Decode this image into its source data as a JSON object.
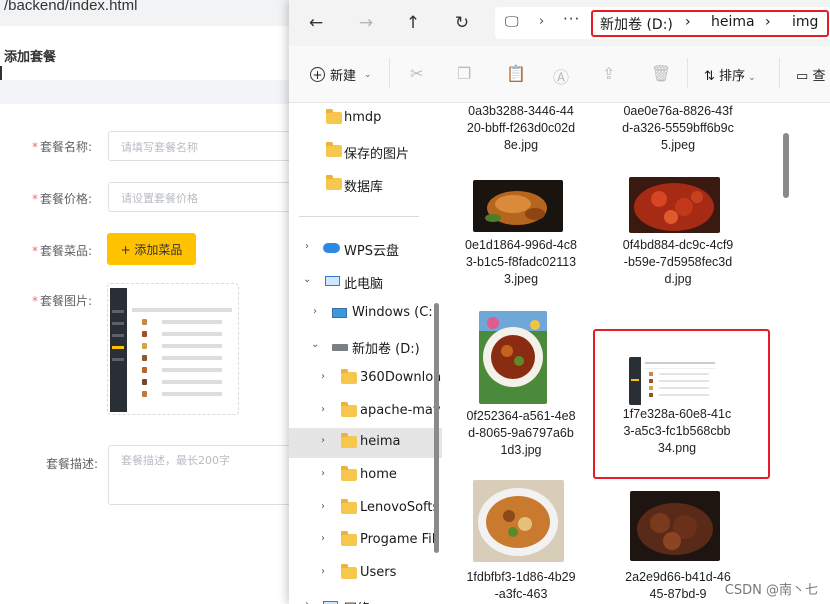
{
  "browser": {
    "url": "/backend/index.html"
  },
  "form": {
    "title": "添加套餐",
    "name_label": "套餐名称:",
    "name_placeholder": "请填写套餐名称",
    "price_label": "套餐价格:",
    "price_placeholder": "请设置套餐价格",
    "dishes_label": "套餐菜品:",
    "add_dish_button": "+ 添加菜品",
    "image_label": "套餐图片:",
    "desc_label": "套餐描述:",
    "desc_placeholder": "套餐描述，最长200字"
  },
  "explorer": {
    "breadcrumb": [
      "新加卷 (D:)",
      "heima",
      "img"
    ],
    "toolbar": {
      "new_label": "新建",
      "sort_label": "排序",
      "view_label": "查"
    },
    "nav_items": [
      {
        "label": "hmdp",
        "icon": "folder-icon"
      },
      {
        "label": "保存的图片",
        "icon": "folder-icon"
      },
      {
        "label": "数据库",
        "icon": "folder-icon"
      },
      {
        "label": "WPS云盘",
        "icon": "cloud-icon"
      },
      {
        "label": "此电脑",
        "icon": "pc-icon"
      },
      {
        "label": "Windows  (C:)",
        "icon": "windows-drive-icon"
      },
      {
        "label": "新加卷 (D:)",
        "icon": "drive-icon"
      },
      {
        "label": "360Downloa",
        "icon": "folder-icon"
      },
      {
        "label": "apache-mav",
        "icon": "folder-icon"
      },
      {
        "label": "heima",
        "icon": "folder-icon",
        "selected": true
      },
      {
        "label": "home",
        "icon": "folder-icon"
      },
      {
        "label": "LenovoSofts",
        "icon": "folder-icon"
      },
      {
        "label": "Progame Fil",
        "icon": "folder-icon"
      },
      {
        "label": "Users",
        "icon": "folder-icon"
      },
      {
        "label": "网络",
        "icon": "network-icon"
      }
    ],
    "files": [
      {
        "name": "0a3b3288-3446-4420-bbff-f263d0c02d8e.jpg"
      },
      {
        "name": "0ae0e76a-8826-43fd-a326-5559bff6b9c5.jpeg"
      },
      {
        "name": "0e1d1864-996d-4c83-b1c5-f8fadc021133.jpeg"
      },
      {
        "name": "0f4bd884-dc9c-4cf9-b59e-7d5958fec3dd.jpg"
      },
      {
        "name": "0f252364-a561-4e8d-8065-9a6797a6b1d3.jpg"
      },
      {
        "name": "1f7e328a-60e8-41c3-a5c3-fc1b568cbb34.png",
        "highlighted": true
      },
      {
        "name": "1fdbfbf3-1d86-4b29-a3fc-463"
      },
      {
        "name": "2a2e9d66-b41d-4645-87bd-9"
      }
    ]
  },
  "watermark": "CSDN @南丶七",
  "colors": {
    "highlight": "#e81c24",
    "accent": "#ffc200"
  }
}
